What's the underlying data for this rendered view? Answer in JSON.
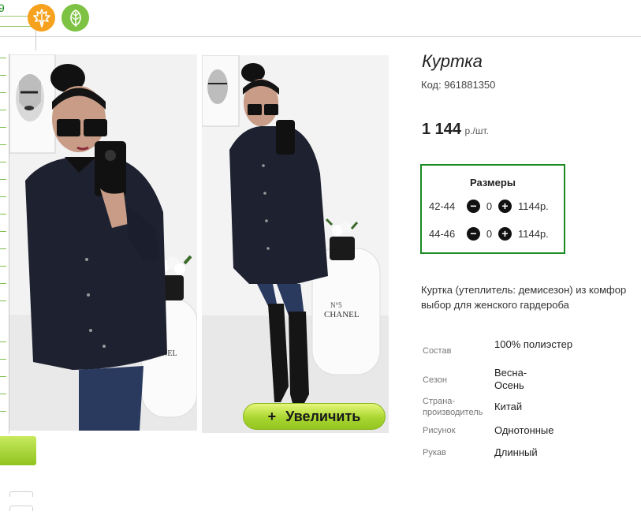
{
  "product": {
    "title": "Куртка",
    "code": "Код: 961881350",
    "price_amount": "1 144",
    "price_unit": "р./шт."
  },
  "sizes": {
    "header": "Размеры",
    "rows": [
      {
        "label": "42-44",
        "minus": "−",
        "qty": "0",
        "plus": "+",
        "price": "1144р."
      },
      {
        "label": "44-46",
        "minus": "−",
        "qty": "0",
        "plus": "+",
        "price": "1144р."
      }
    ]
  },
  "description": {
    "line1": "Куртка (утеплитель: демисезон) из комфор",
    "line2": "выбор для женского гардероба"
  },
  "properties": [
    {
      "key": "Состав",
      "value": "100% полиэстер"
    },
    {
      "key": "Сезон",
      "value": "Весна-Осень"
    },
    {
      "key": "Страна-производитель",
      "value": "Китай"
    },
    {
      "key": "Рисунок",
      "value": "Однотонные"
    },
    {
      "key": "Рукав",
      "value": "Длинный"
    }
  ],
  "gallery": {
    "zoom_icon": "+",
    "zoom_label": "Увеличить",
    "photo1_sign": "CHANEL",
    "photo2_sign": "CHANEL"
  },
  "header": {
    "corner_glyph": "9",
    "badge_left_icon": "maple-leaf-icon",
    "badge_right_icon": "leaf-icon"
  },
  "colors": {
    "accent_green": "#1a8a22",
    "badge_orange": "#f6a21e",
    "badge_green": "#7dc242",
    "button_green": "#a9d630"
  }
}
